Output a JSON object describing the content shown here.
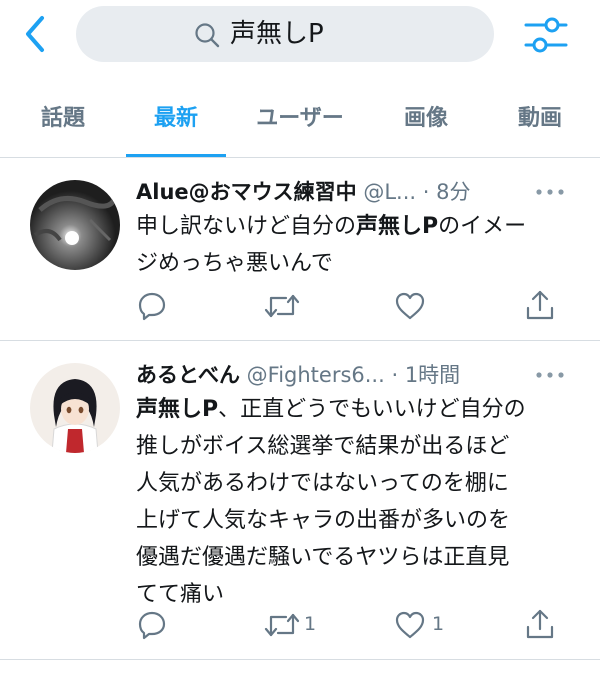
{
  "search": {
    "query": "声無しP"
  },
  "tabs": [
    {
      "label": "話題"
    },
    {
      "label": "最新"
    },
    {
      "label": "ユーザー"
    },
    {
      "label": "画像"
    },
    {
      "label": "動画"
    }
  ],
  "active_tab": "最新",
  "tweets": [
    {
      "name": "Alue@おマウス練習中",
      "handle": "@L...",
      "time": "· 8分",
      "text_a": "申し訳ないけど自分の",
      "text_bold": "声無しP",
      "text_b": "のイメー",
      "text_c": "ジめっちゃ悪いんで",
      "retweets": "",
      "likes": ""
    },
    {
      "name": "あるとべん",
      "handle": "@Fighters6...",
      "time": "· 1時間",
      "text_bold": "声無しP",
      "line1_rest": "、正直どうでもいいけど自分の",
      "line2": "推しがボイス総選挙で結果が出るほど",
      "line3": "人気があるわけではないってのを棚に",
      "line4": "上げて人気なキャラの出番が多いのを",
      "line5": "優遇だ優遇だ騒いでるヤツらは正直見",
      "line6": "てて痛い",
      "retweets": "1",
      "likes": "1"
    }
  ],
  "icons": {
    "back": "chevron-left-icon",
    "search": "search-icon",
    "filter": "sliders-icon",
    "reply": "reply-icon",
    "retweet": "retweet-icon",
    "like": "heart-icon",
    "share": "share-icon",
    "more": "more-icon"
  },
  "colors": {
    "accent": "#1da1f2",
    "muted": "#657786",
    "text": "#14171a",
    "search_bg": "#e8ecf0"
  }
}
